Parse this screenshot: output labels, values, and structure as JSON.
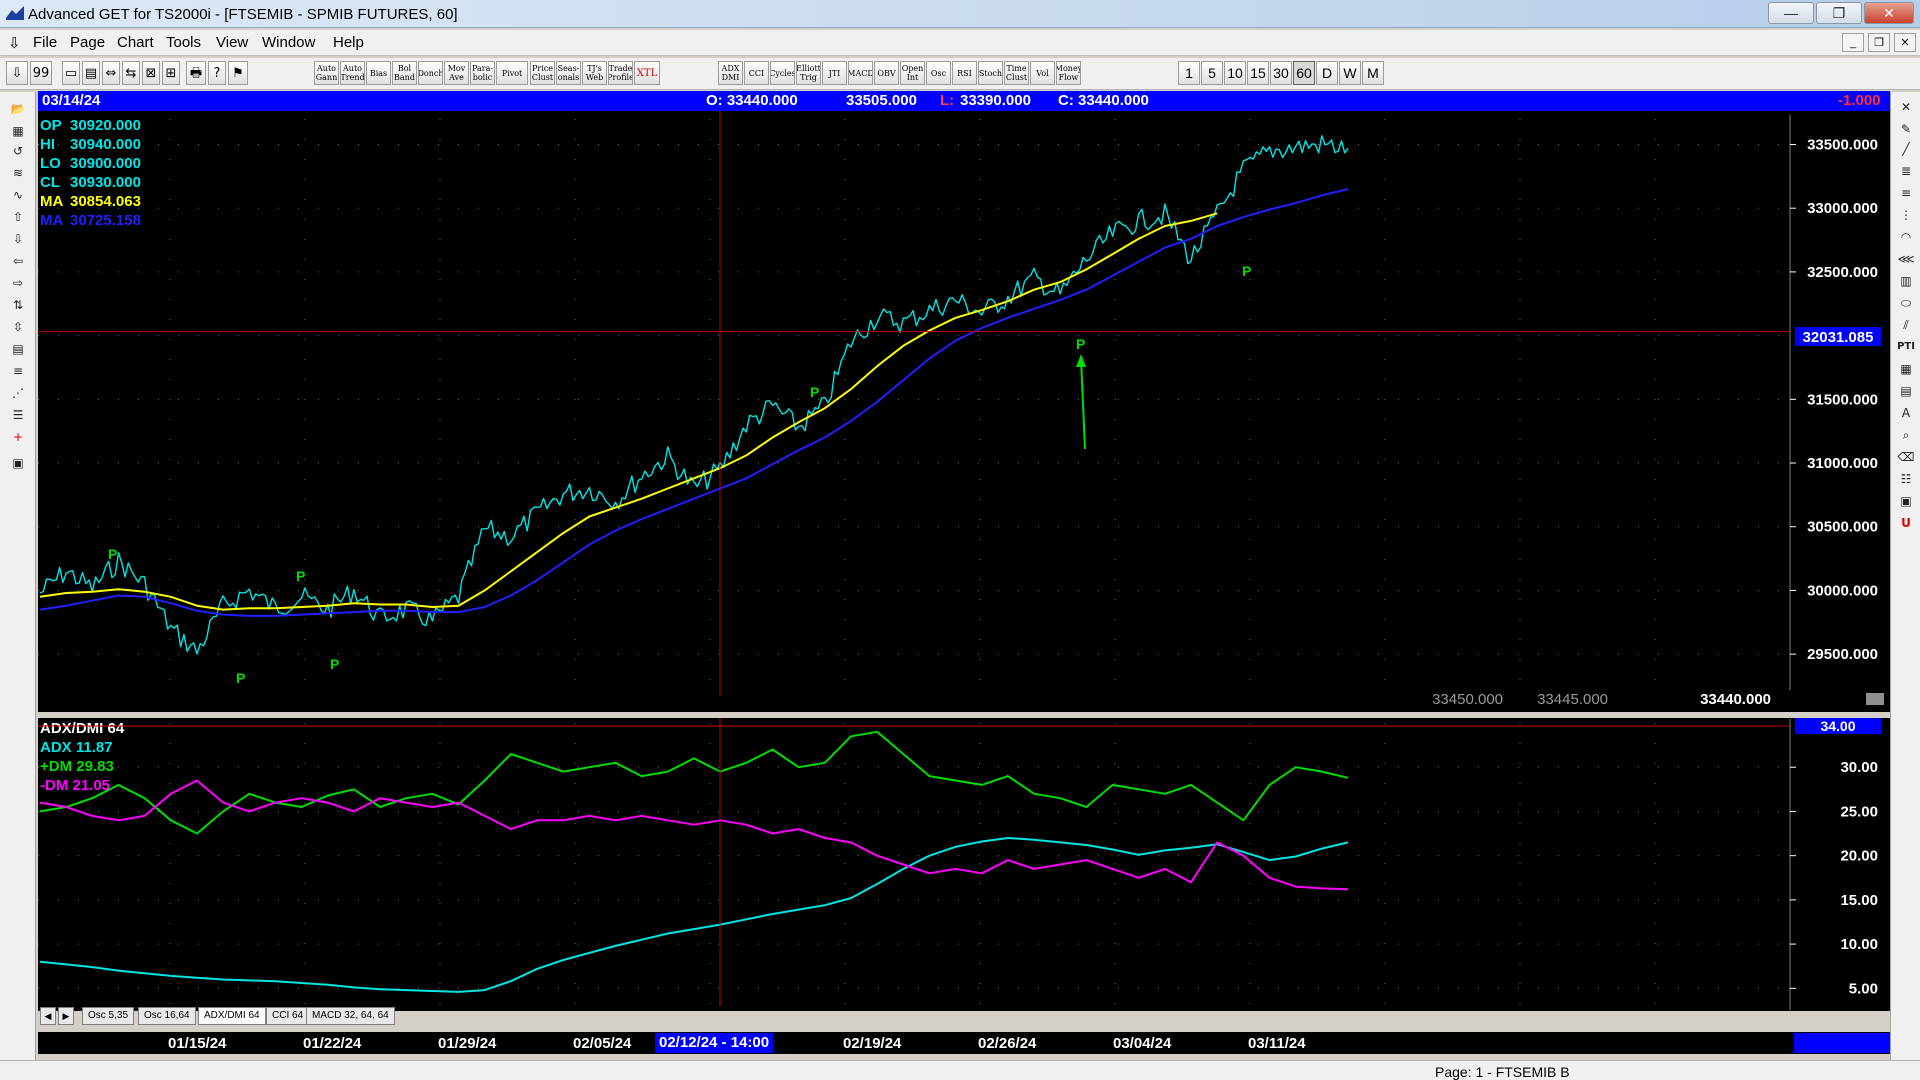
{
  "window": {
    "title": "Advanced GET for TS2000i - [FTSEMIB - SPMIB FUTURES, 60]",
    "buttons": [
      "—",
      "❐",
      "✕"
    ]
  },
  "menu": {
    "items": [
      "File",
      "Page",
      "Chart",
      "Tools",
      "View",
      "Window",
      "Help"
    ]
  },
  "toolbar": {
    "icon_buttons": [
      "⇩",
      "99",
      "▭",
      "▤",
      "⇔",
      "⇆",
      "⊠",
      "⊞",
      "🖶",
      "?",
      "⚑"
    ],
    "study_buttons": [
      "Auto Gann",
      "Auto Trend",
      "Bias",
      "Bol Band",
      "Donch",
      "Mov Ave",
      "Para-bolic",
      "Pivot",
      "Price Clust",
      "Seas-onals",
      "TJ's Web",
      "Trade Profile",
      "XTL",
      "ADX DMI",
      "CCI",
      "Cycles",
      "Elliott Trig",
      "JTI",
      "MACD",
      "OBV",
      "Open Int",
      "Osc",
      "RSI",
      "Stoch",
      "Time Clust",
      "Vol",
      "Money Flow"
    ],
    "periods": [
      "1",
      "5",
      "10",
      "15",
      "30",
      "60",
      "D",
      "W",
      "M"
    ],
    "active_period": "60"
  },
  "header": {
    "date": "03/14/24",
    "open": "O: 33440.000",
    "high": "33505.000",
    "low_label": "L:",
    "low": "33390.000",
    "close": "C: 33440.000",
    "change": "-1.000"
  },
  "price_panel": {
    "readouts": [
      {
        "label": "OP",
        "value": "30920.000",
        "color": "#00e5e5"
      },
      {
        "label": "HI",
        "value": "30940.000",
        "color": "#00e5e5"
      },
      {
        "label": "LO",
        "value": "30900.000",
        "color": "#00e5e5"
      },
      {
        "label": "CL",
        "value": "30930.000",
        "color": "#00e5e5"
      },
      {
        "label": "MA",
        "value": "30854.063",
        "color": "#ffff00"
      },
      {
        "label": "MA",
        "value": "30725.158",
        "color": "#2020ff"
      }
    ],
    "cursor_price": "32031.085",
    "bottom_values": [
      "33450.000",
      "33445.000",
      "33440.000"
    ],
    "pivot_label": "P"
  },
  "adx_panel": {
    "readouts": [
      {
        "label": "ADX/DMI 64",
        "color": "#ffffff"
      },
      {
        "label": "ADX 11.87",
        "color": "#00e5e5"
      },
      {
        "label": "+DM 29.83",
        "color": "#00dd00"
      },
      {
        "label": "-DM 21.05",
        "color": "#ff00ff"
      }
    ],
    "level_label": "34.00"
  },
  "chart_data": [
    {
      "type": "line",
      "title": "FTSEMIB - SPMIB FUTURES, 60",
      "ylim": [
        29250,
        33700
      ],
      "yticks": [
        29500,
        30000,
        30500,
        31000,
        31500,
        32000,
        32500,
        33000,
        33500
      ],
      "ytick_labels": [
        "29500.000",
        "30000.000",
        "30500.000",
        "31000.000",
        "31500.000",
        "",
        "32500.000",
        "33000.000",
        "33500.000"
      ],
      "x_labels": [
        "01/15/24",
        "01/22/24",
        "01/29/24",
        "02/05/24",
        "02/12/24 - 14:00",
        "02/19/24",
        "02/26/24",
        "03/04/24",
        "03/11/24"
      ],
      "x": [
        0,
        2,
        4,
        6,
        8,
        10,
        12,
        14,
        16,
        18,
        20,
        22,
        24,
        26,
        28,
        30,
        32,
        34,
        36,
        38,
        40,
        42,
        44,
        46,
        48,
        50,
        52,
        54,
        56,
        58,
        60,
        62,
        64,
        66,
        68,
        70,
        72,
        74,
        76,
        78,
        80,
        82,
        84,
        86,
        88,
        90,
        92,
        94,
        96,
        98,
        100
      ],
      "series": [
        {
          "name": "Close",
          "color": "#00e5e5",
          "values": [
            29980,
            30150,
            30020,
            30230,
            30050,
            29700,
            29520,
            29880,
            30000,
            29860,
            29950,
            29850,
            30000,
            29780,
            29850,
            29760,
            29950,
            30480,
            30420,
            30600,
            30760,
            30800,
            30700,
            30900,
            31050,
            30800,
            30950,
            31300,
            31450,
            31280,
            31450,
            31950,
            32150,
            32100,
            32200,
            32280,
            32180,
            32300,
            32450,
            32320,
            32600,
            32800,
            32900,
            32950,
            32600,
            32950,
            33300,
            33450,
            33480,
            33500,
            33470
          ]
        },
        {
          "name": "MA",
          "color": "#ffff00",
          "values": [
            29950,
            29980,
            29990,
            30010,
            29990,
            29950,
            29880,
            29850,
            29860,
            29860,
            29870,
            29880,
            29900,
            29890,
            29890,
            29870,
            29880,
            30000,
            30150,
            30300,
            30450,
            30580,
            30650,
            30720,
            30800,
            30880,
            30960,
            31060,
            31200,
            31320,
            31430,
            31580,
            31760,
            31920,
            32040,
            32140,
            32200,
            32270,
            32360,
            32420,
            32520,
            32640,
            32760,
            32860,
            32900,
            32960,
            null,
            null,
            null,
            null,
            null
          ]
        },
        {
          "name": "MA2",
          "color": "#2020ff",
          "values": [
            29850,
            29880,
            29920,
            29960,
            29950,
            29900,
            29840,
            29810,
            29800,
            29800,
            29810,
            29820,
            29830,
            29840,
            29840,
            29830,
            29830,
            29870,
            29960,
            30080,
            30220,
            30360,
            30470,
            30560,
            30640,
            30720,
            30800,
            30880,
            30990,
            31100,
            31200,
            31330,
            31480,
            31650,
            31820,
            31960,
            32060,
            32140,
            32210,
            32280,
            32360,
            32470,
            32580,
            32690,
            32760,
            32860,
            32930,
            32990,
            33040,
            33100,
            33150
          ]
        }
      ]
    },
    {
      "type": "line",
      "title": "ADX/DMI 64",
      "ylim": [
        3,
        35
      ],
      "yticks": [
        5,
        10,
        15,
        20,
        25,
        30
      ],
      "ytick_labels": [
        "5.00",
        "10.00",
        "15.00",
        "20.00",
        "25.00",
        "30.00"
      ],
      "x": [
        0,
        2,
        4,
        6,
        8,
        10,
        12,
        14,
        16,
        18,
        20,
        22,
        24,
        26,
        28,
        30,
        32,
        34,
        36,
        38,
        40,
        42,
        44,
        46,
        48,
        50,
        52,
        54,
        56,
        58,
        60,
        62,
        64,
        66,
        68,
        70,
        72,
        74,
        76,
        78,
        80,
        82,
        84,
        86,
        88,
        90,
        92,
        94,
        96,
        98,
        100
      ],
      "series": [
        {
          "name": "ADX",
          "color": "#00e5e5",
          "values": [
            8.0,
            7.7,
            7.4,
            7.0,
            6.7,
            6.4,
            6.2,
            6.0,
            5.9,
            5.8,
            5.6,
            5.4,
            5.1,
            4.9,
            4.8,
            4.7,
            4.6,
            4.8,
            5.8,
            7.2,
            8.2,
            9.0,
            9.8,
            10.5,
            11.2,
            11.7,
            12.2,
            12.8,
            13.4,
            13.9,
            14.4,
            15.2,
            16.8,
            18.5,
            20.0,
            21.0,
            21.6,
            22.0,
            21.8,
            21.5,
            21.2,
            20.7,
            20.1,
            20.6,
            20.9,
            21.3,
            20.4,
            19.5,
            19.9,
            20.8,
            21.5
          ]
        },
        {
          "name": "+DM",
          "color": "#00dd00",
          "values": [
            25.0,
            25.5,
            26.5,
            28.0,
            26.5,
            24.0,
            22.5,
            25.0,
            27.0,
            26.0,
            25.5,
            26.8,
            27.5,
            25.5,
            26.5,
            27.0,
            25.8,
            28.5,
            31.5,
            30.5,
            29.5,
            30.0,
            30.5,
            29.0,
            29.5,
            31.0,
            29.5,
            30.5,
            32.0,
            30.0,
            30.5,
            33.5,
            34.0,
            31.5,
            29.0,
            28.5,
            28.0,
            29.0,
            27.0,
            26.5,
            25.5,
            28.0,
            27.5,
            27.0,
            28.0,
            26.0,
            24.0,
            28.0,
            30.0,
            29.5,
            28.8
          ]
        },
        {
          "name": "-DM",
          "color": "#ff00ff",
          "values": [
            26.0,
            25.5,
            24.5,
            24.0,
            24.5,
            27.0,
            28.5,
            26.0,
            25.0,
            26.0,
            26.5,
            26.0,
            25.0,
            26.5,
            26.0,
            25.5,
            26.0,
            24.5,
            23.0,
            24.0,
            24.0,
            24.5,
            24.0,
            24.5,
            24.0,
            23.5,
            24.0,
            23.5,
            22.5,
            23.0,
            22.0,
            21.5,
            20.0,
            19.0,
            18.0,
            18.5,
            18.0,
            19.5,
            18.5,
            19.0,
            19.5,
            18.5,
            17.5,
            18.5,
            17.0,
            21.5,
            20.0,
            17.5,
            16.5,
            16.3,
            16.2
          ]
        }
      ]
    }
  ],
  "osc_tabs": [
    "Osc 5,35",
    "Osc 16,64",
    "ADX/DMI 64",
    "CCI 64",
    "MACD 32, 64, 64"
  ],
  "active_osc_tab": "ADX/DMI 64",
  "date_axis": {
    "labels": [
      "01/15/24",
      "01/22/24",
      "01/29/24",
      "02/05/24",
      "02/12/24 - 14:00",
      "02/19/24",
      "02/26/24",
      "03/04/24",
      "03/11/24"
    ]
  },
  "status": {
    "text": "Page: 1 - FTSEMIB B"
  },
  "colors": {
    "chart_bg": "#000000",
    "header_bg": "#0000ff",
    "cursor_line": "#c00000",
    "pivot": "#00dd00"
  }
}
